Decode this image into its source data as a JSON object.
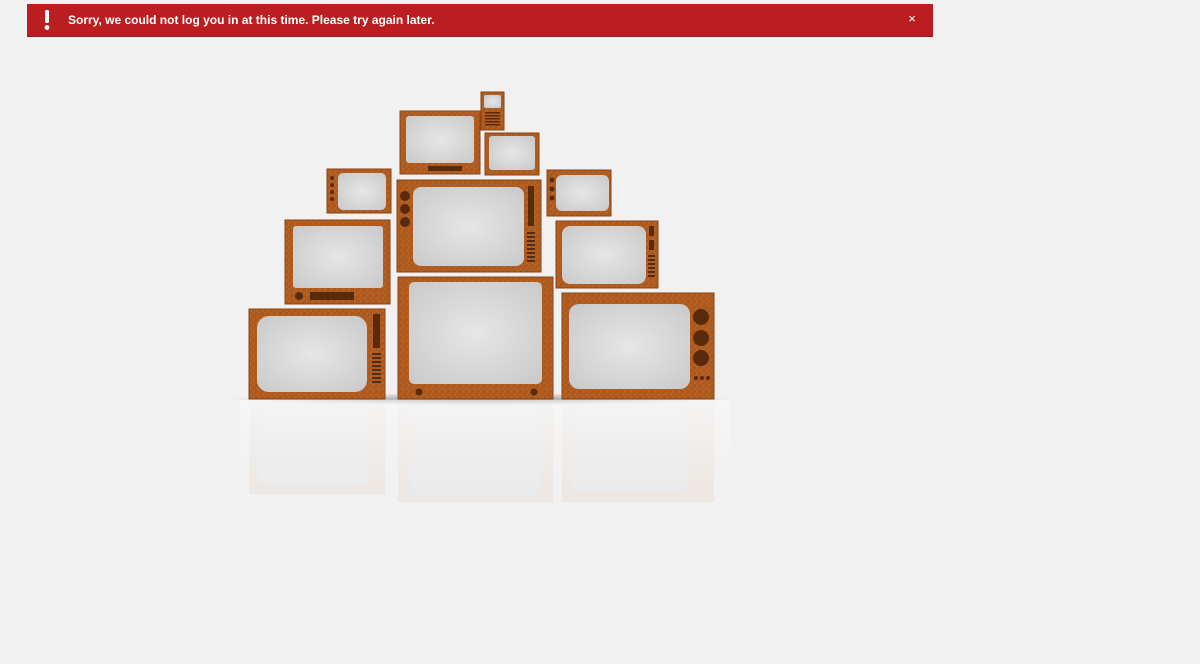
{
  "alert": {
    "message": "Sorry, we could not log you in at this time. Please try again later.",
    "close_symbol": "×",
    "icon": "exclamation-icon",
    "background_color": "#bb1e21",
    "text_color": "#ffffff"
  },
  "illustration": {
    "name": "stacked-retro-televisions",
    "wood_color": "#b45f22",
    "screen_color": "#dedede",
    "background_color": "#f1f1f1"
  }
}
